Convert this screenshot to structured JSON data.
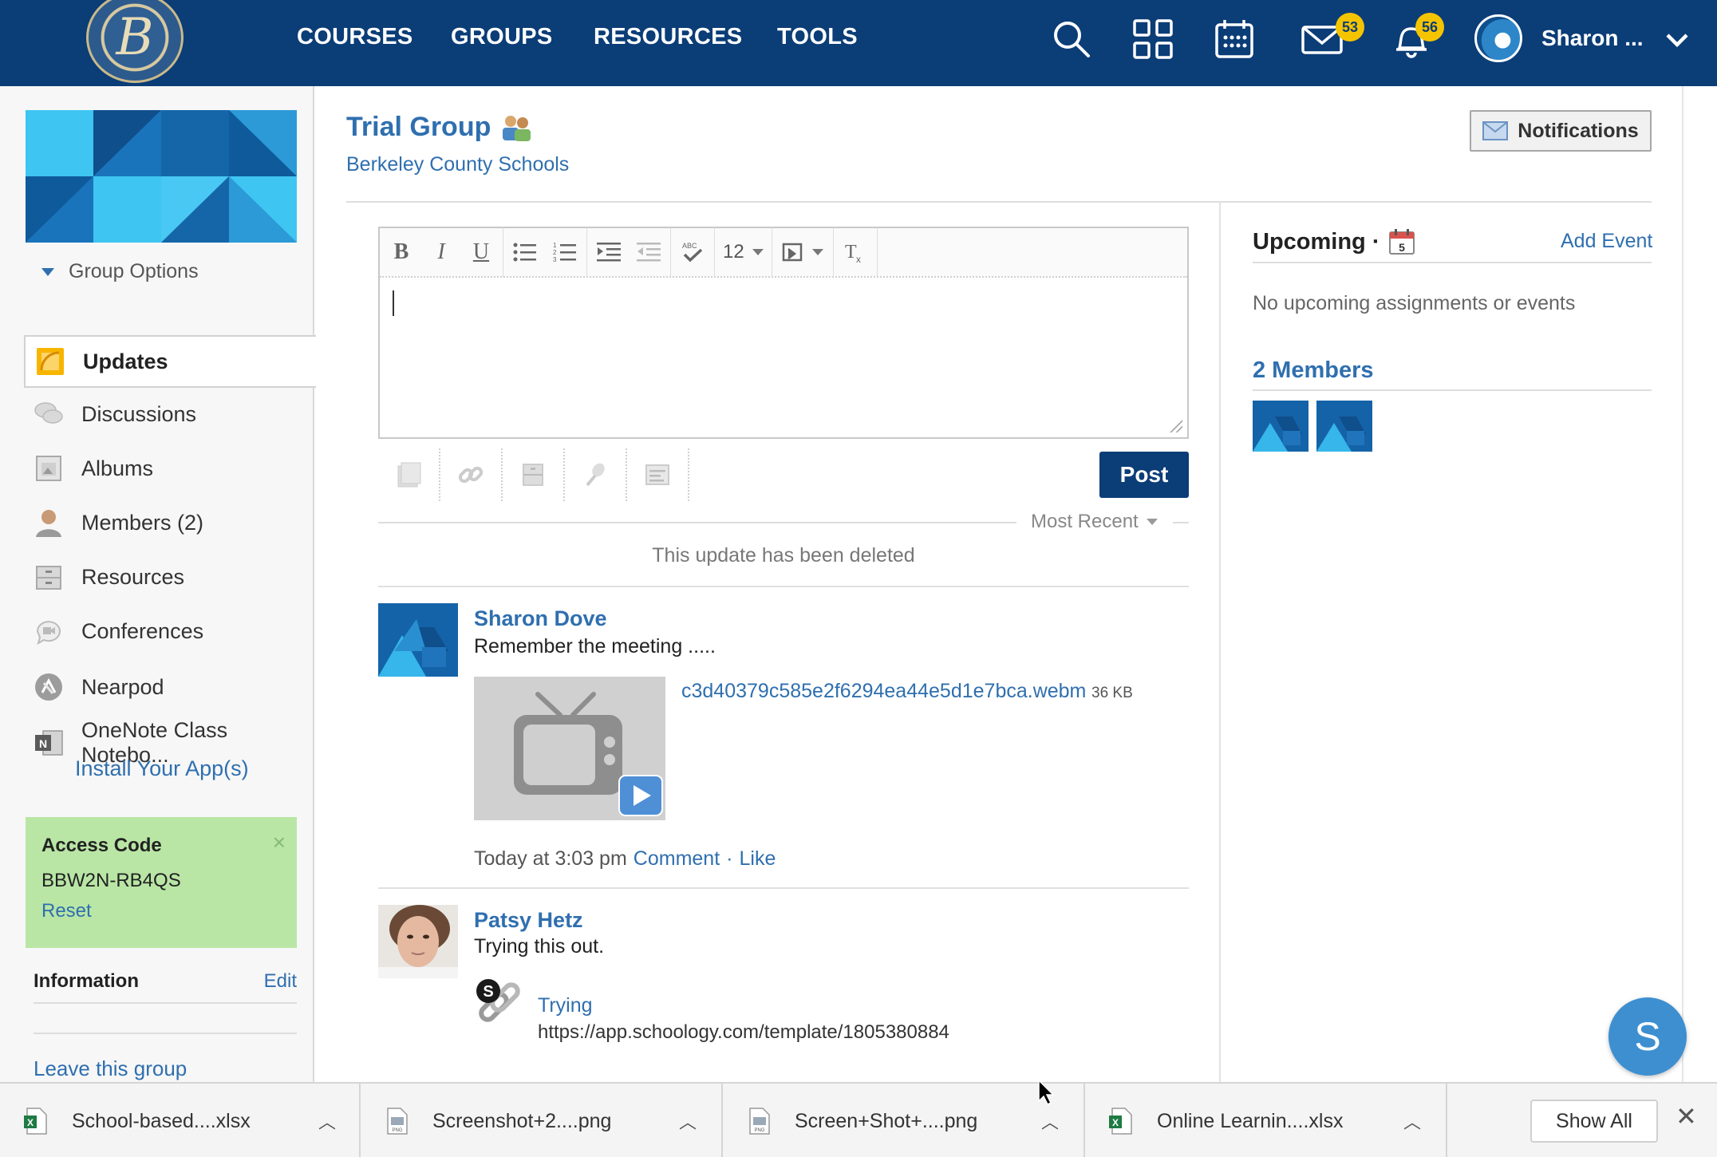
{
  "nav": {
    "links": [
      "COURSES",
      "GROUPS",
      "RESOURCES",
      "TOOLS"
    ],
    "messages_badge": "53",
    "notifications_badge": "56",
    "user_name": "Sharon ...",
    "icons": [
      "search-icon",
      "apps-grid-icon",
      "calendar-icon",
      "mail-icon",
      "bell-icon",
      "avatar",
      "chevron-down-icon"
    ]
  },
  "sidebar": {
    "group_options": "Group Options",
    "items": [
      {
        "label": "Updates",
        "icon": "updates-icon"
      },
      {
        "label": "Discussions",
        "icon": "discussions-icon"
      },
      {
        "label": "Albums",
        "icon": "albums-icon"
      },
      {
        "label": "Members (2)",
        "icon": "members-icon"
      },
      {
        "label": "Resources",
        "icon": "resources-icon"
      },
      {
        "label": "Conferences",
        "icon": "conferences-icon"
      },
      {
        "label": "Nearpod",
        "icon": "nearpod-icon"
      },
      {
        "label": "OneNote Class Notebo...",
        "icon": "onenote-icon"
      }
    ],
    "install_apps": "Install Your App(s)",
    "access_code": {
      "title": "Access Code",
      "code": "BBW2N-RB4QS",
      "reset": "Reset",
      "close": "×"
    },
    "information": {
      "title": "Information",
      "edit": "Edit"
    },
    "leave": "Leave this group"
  },
  "header": {
    "title": "Trial Group",
    "subtitle": "Berkeley County Schools",
    "notifications_button": "Notifications"
  },
  "editor": {
    "font_size": "12",
    "post_button": "Post"
  },
  "feed": {
    "sort_label": "Most Recent",
    "deleted_message": "This update has been deleted",
    "posts": [
      {
        "author": "Sharon Dove",
        "text": "Remember the meeting .....",
        "attachment_name": "c3d40379c585e2f6294ea44e5d1e7bca.webm",
        "attachment_size": "36 KB",
        "time": "Today at 3:03 pm",
        "comment": "Comment",
        "separator": "·",
        "like": "Like"
      },
      {
        "author": "Patsy Hetz",
        "text": "Trying this out.",
        "link_title": "Trying",
        "link_url": "https://app.schoology.com/template/1805380884"
      }
    ]
  },
  "right": {
    "upcoming_title": "Upcoming ·",
    "calendar_day": "5",
    "add_event": "Add Event",
    "no_upcoming": "No upcoming assignments or events",
    "members_title": "2 Members"
  },
  "chat_fab": "S",
  "downloads": {
    "items": [
      {
        "name": "School-based....xlsx",
        "type": "xlsx"
      },
      {
        "name": "Screenshot+2....png",
        "type": "png"
      },
      {
        "name": "Screen+Shot+....png",
        "type": "png"
      },
      {
        "name": "Online Learnin....xlsx",
        "type": "xlsx"
      }
    ],
    "show_all": "Show All",
    "close": "✕"
  },
  "colors": {
    "nav_bg": "#0b3d77",
    "link": "#2f6faf",
    "badge": "#f5c400",
    "access_bg": "#b9e6a5",
    "post_button": "#0b3d77"
  }
}
